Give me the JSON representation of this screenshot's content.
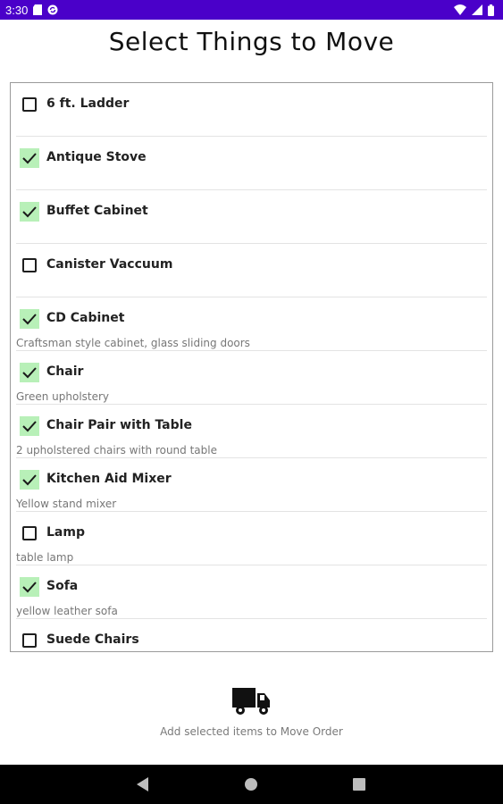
{
  "status_bar": {
    "time": "3:30",
    "icons_left": [
      "sd-card-icon",
      "sync-icon"
    ],
    "icons_right": [
      "wifi-icon",
      "signal-icon",
      "battery-icon"
    ],
    "background": "#4a00c9"
  },
  "title": "Select Things to Move",
  "items": [
    {
      "name": "6 ft. Ladder",
      "description": "",
      "checked": false
    },
    {
      "name": "Antique Stove",
      "description": "",
      "checked": true
    },
    {
      "name": "Buffet Cabinet",
      "description": "",
      "checked": true
    },
    {
      "name": "Canister Vaccuum",
      "description": "",
      "checked": false
    },
    {
      "name": "CD Cabinet",
      "description": "Craftsman style cabinet, glass sliding doors",
      "checked": true
    },
    {
      "name": "Chair",
      "description": "Green upholstery",
      "checked": true
    },
    {
      "name": "Chair Pair with Table",
      "description": "2 upholstered chairs with round table",
      "checked": true
    },
    {
      "name": "Kitchen Aid Mixer",
      "description": "Yellow stand mixer",
      "checked": true
    },
    {
      "name": "Lamp",
      "description": "table lamp",
      "checked": false
    },
    {
      "name": "Sofa",
      "description": "yellow leather sofa",
      "checked": true
    },
    {
      "name": "Suede Chairs",
      "description": "",
      "checked": false
    }
  ],
  "action": {
    "icon": "truck-icon",
    "label": "Add selected items to Move Order"
  },
  "nav": {
    "buttons": [
      "back-icon",
      "home-icon",
      "recents-icon"
    ]
  },
  "colors": {
    "checked_bg": "#b8f0b8",
    "nav_bg": "#000000"
  }
}
